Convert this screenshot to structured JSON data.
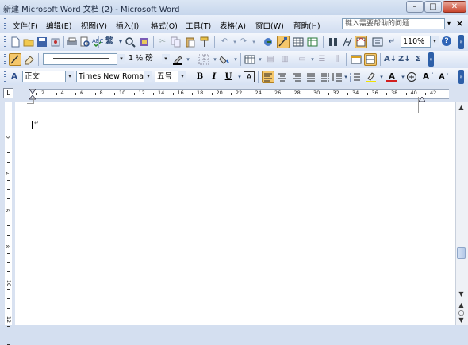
{
  "window": {
    "title": "新建 Microsoft Word 文档 (2) - Microsoft Word",
    "minimize": "–",
    "maximize": "□",
    "close": "✕"
  },
  "menu": {
    "items": [
      "文件(F)",
      "编辑(E)",
      "视图(V)",
      "插入(I)",
      "格式(O)",
      "工具(T)",
      "表格(A)",
      "窗口(W)",
      "帮助(H)"
    ],
    "help_placeholder": "键入需要帮助的问题",
    "help_dropdown": "▾",
    "close_doc": "×"
  },
  "standard_toolbar": {
    "zoom": "110%",
    "traditional_chinese": "繁",
    "zoom_dropdown": "▾",
    "help_icon": "?"
  },
  "drawing_toolbar": {
    "line_weight": "1 ½ 磅",
    "line_style_dropdown": "▾",
    "weight_dropdown": "▾"
  },
  "formatting_toolbar": {
    "style": "正文",
    "font": "Times New Roman",
    "size": "五号",
    "bold": "B",
    "italic": "I",
    "underline": "U",
    "char_border": "A",
    "font_color": "A",
    "enlarge": "A",
    "shrink": "A",
    "style_dropdown": "▾",
    "font_dropdown": "▾",
    "size_dropdown": "▾"
  },
  "ruler": {
    "tab_selector": "L",
    "marks": [
      "2",
      "4",
      "6",
      "8",
      "10",
      "12",
      "14",
      "16",
      "18",
      "20",
      "22",
      "24",
      "26",
      "28",
      "30",
      "32",
      "34",
      "36",
      "38",
      "40",
      "42"
    ],
    "vertical_marks": [
      "2",
      "4",
      "6",
      "8",
      "10",
      "12"
    ]
  },
  "scrollbar": {
    "up": "▲",
    "down": "▼",
    "prev_page": "▲",
    "next_page": "▼",
    "browse_object": "○"
  },
  "document": {
    "paragraph_mark": "↵"
  },
  "icons": [
    "new-document-icon",
    "open-icon",
    "save-icon",
    "permission-icon",
    "print-icon",
    "print-preview-icon",
    "spelling-icon",
    "research-icon",
    "cut-icon",
    "copy-icon",
    "paste-icon",
    "format-painter-icon",
    "undo-icon",
    "redo-icon",
    "hyperlink-icon",
    "tables-borders-icon",
    "insert-table-icon",
    "insert-excel-icon",
    "columns-icon",
    "drawing-icon",
    "document-map-icon",
    "show-hide-icon",
    "read-icon",
    "help-icon"
  ]
}
